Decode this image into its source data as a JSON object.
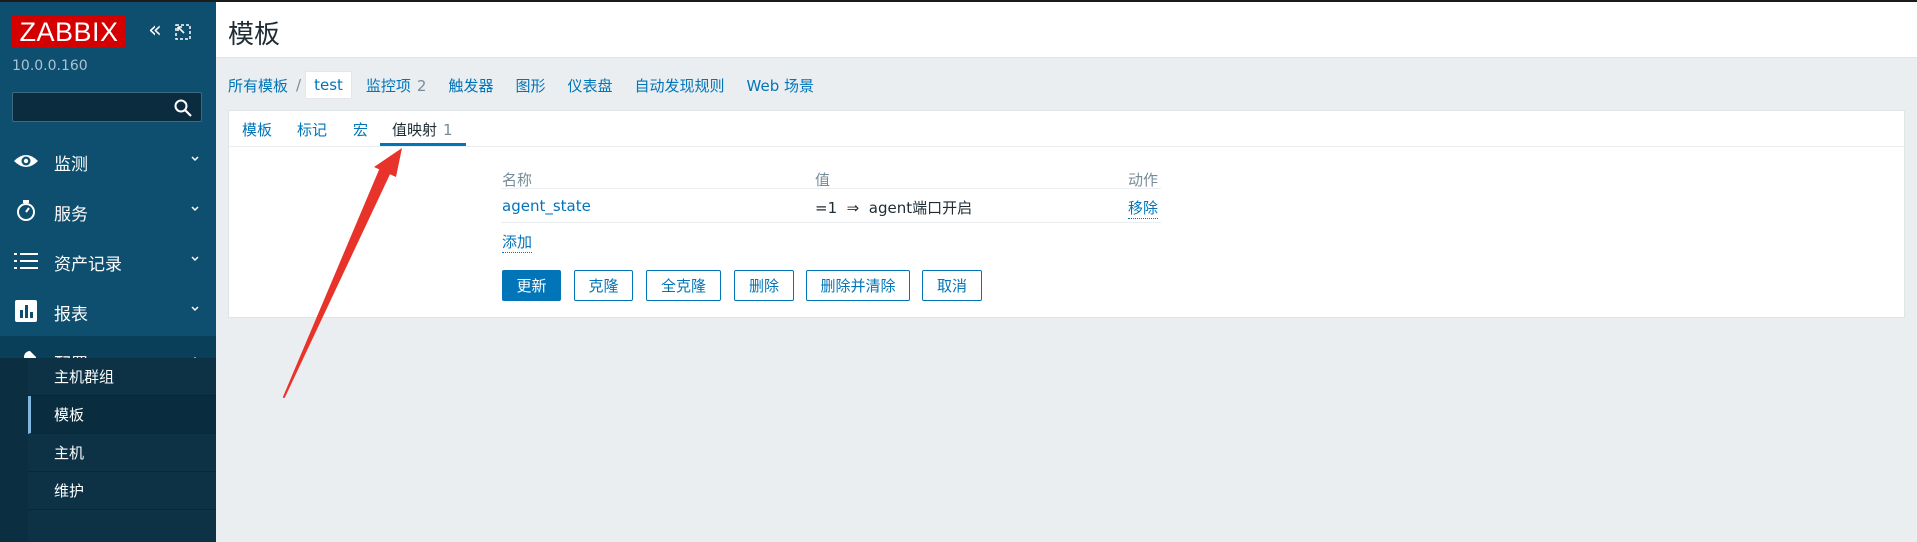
{
  "sidebar": {
    "logo": "ZABBIX",
    "server": "10.0.0.160",
    "search": {
      "placeholder": "",
      "value": ""
    },
    "items": [
      {
        "label": "监测",
        "icon": "eye-icon"
      },
      {
        "label": "服务",
        "icon": "stopwatch-icon"
      },
      {
        "label": "资产记录",
        "icon": "list-icon"
      },
      {
        "label": "报表",
        "icon": "bar-chart-icon"
      },
      {
        "label": "配置",
        "icon": "wrench-icon"
      }
    ],
    "submenu": [
      {
        "label": "主机群组"
      },
      {
        "label": "模板"
      },
      {
        "label": "主机"
      },
      {
        "label": "维护"
      }
    ]
  },
  "header": {
    "title": "模板"
  },
  "breadcrumb": {
    "all_templates": "所有模板",
    "separator": "/",
    "current": "test",
    "items": [
      {
        "label": "监控项",
        "count": "2"
      },
      {
        "label": "触发器",
        "count": ""
      },
      {
        "label": "图形",
        "count": ""
      },
      {
        "label": "仪表盘",
        "count": ""
      },
      {
        "label": "自动发现规则",
        "count": ""
      },
      {
        "label": "Web 场景",
        "count": ""
      }
    ]
  },
  "tabs": [
    {
      "label": "模板",
      "count": ""
    },
    {
      "label": "标记",
      "count": ""
    },
    {
      "label": "宏",
      "count": ""
    },
    {
      "label": "值映射",
      "count": "1"
    }
  ],
  "valuemap": {
    "columns": {
      "name": "名称",
      "value": "值",
      "action": "动作"
    },
    "rows": [
      {
        "name": "agent_state",
        "value": "=1  ⇒  agent端口开启",
        "action": "移除"
      }
    ],
    "add": "添加"
  },
  "buttons": {
    "update": "更新",
    "clone": "克隆",
    "full_clone": "全克隆",
    "delete": "删除",
    "delete_clear": "删除并清除",
    "cancel": "取消"
  },
  "colors": {
    "accent": "#0275b8",
    "sidebar": "#0e4f6f",
    "logo": "#d40000",
    "arrow": "#e8332a"
  }
}
